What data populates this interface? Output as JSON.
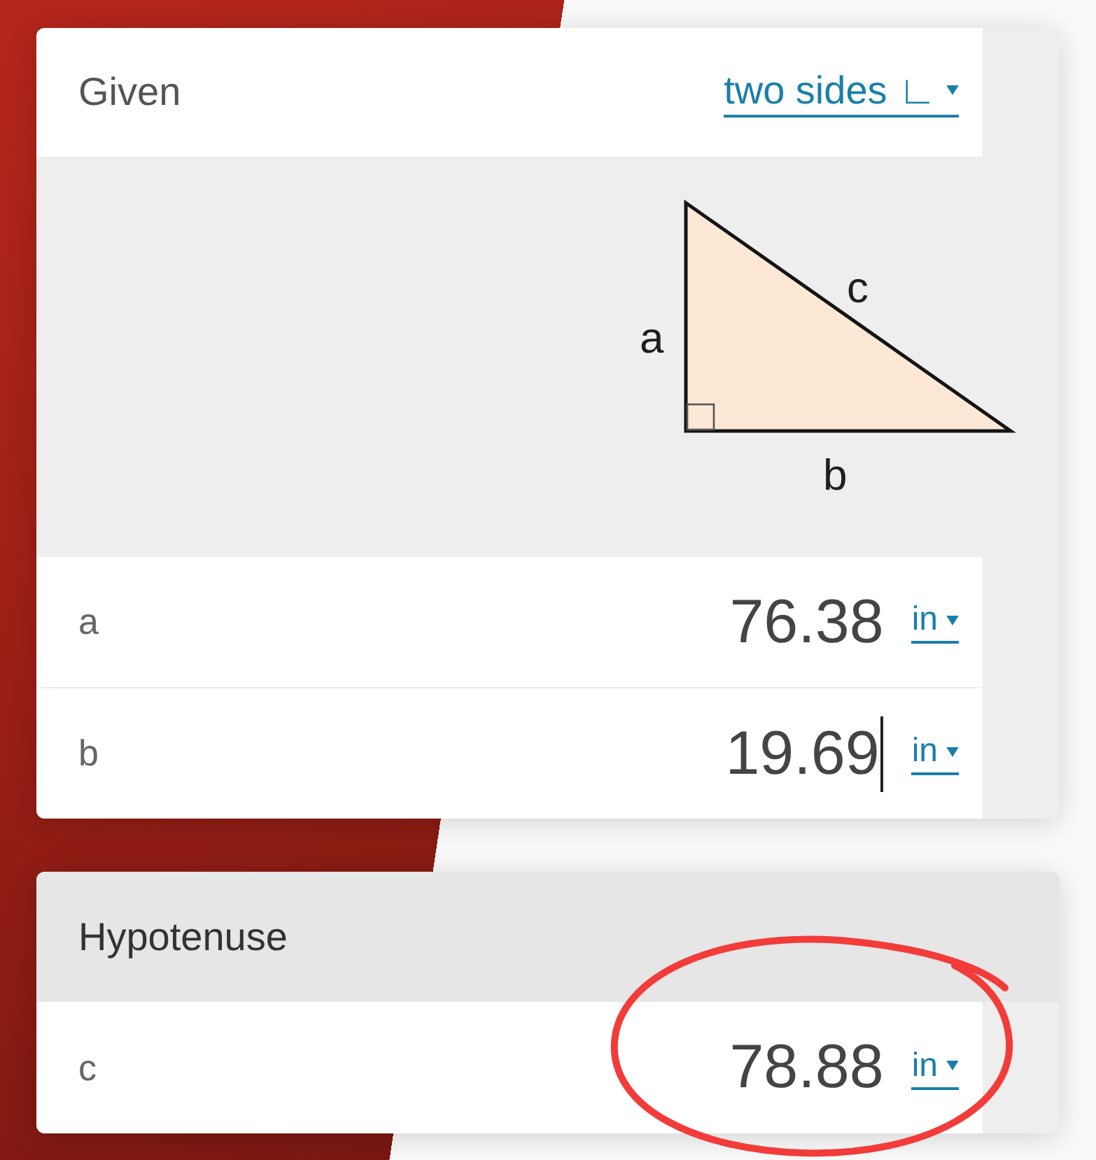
{
  "given": {
    "title": "Given",
    "mode": "two sides ∟",
    "diagram": {
      "side_a": "a",
      "side_c": "c",
      "side_b": "b"
    },
    "inputs": [
      {
        "label": "a",
        "value": "76.38",
        "unit": "in",
        "focused": false
      },
      {
        "label": "b",
        "value": "19.69",
        "unit": "in",
        "focused": true
      }
    ]
  },
  "hypotenuse": {
    "title": "Hypotenuse",
    "rows": [
      {
        "label": "c",
        "value": "78.88",
        "unit": "in",
        "circled": true
      }
    ]
  }
}
